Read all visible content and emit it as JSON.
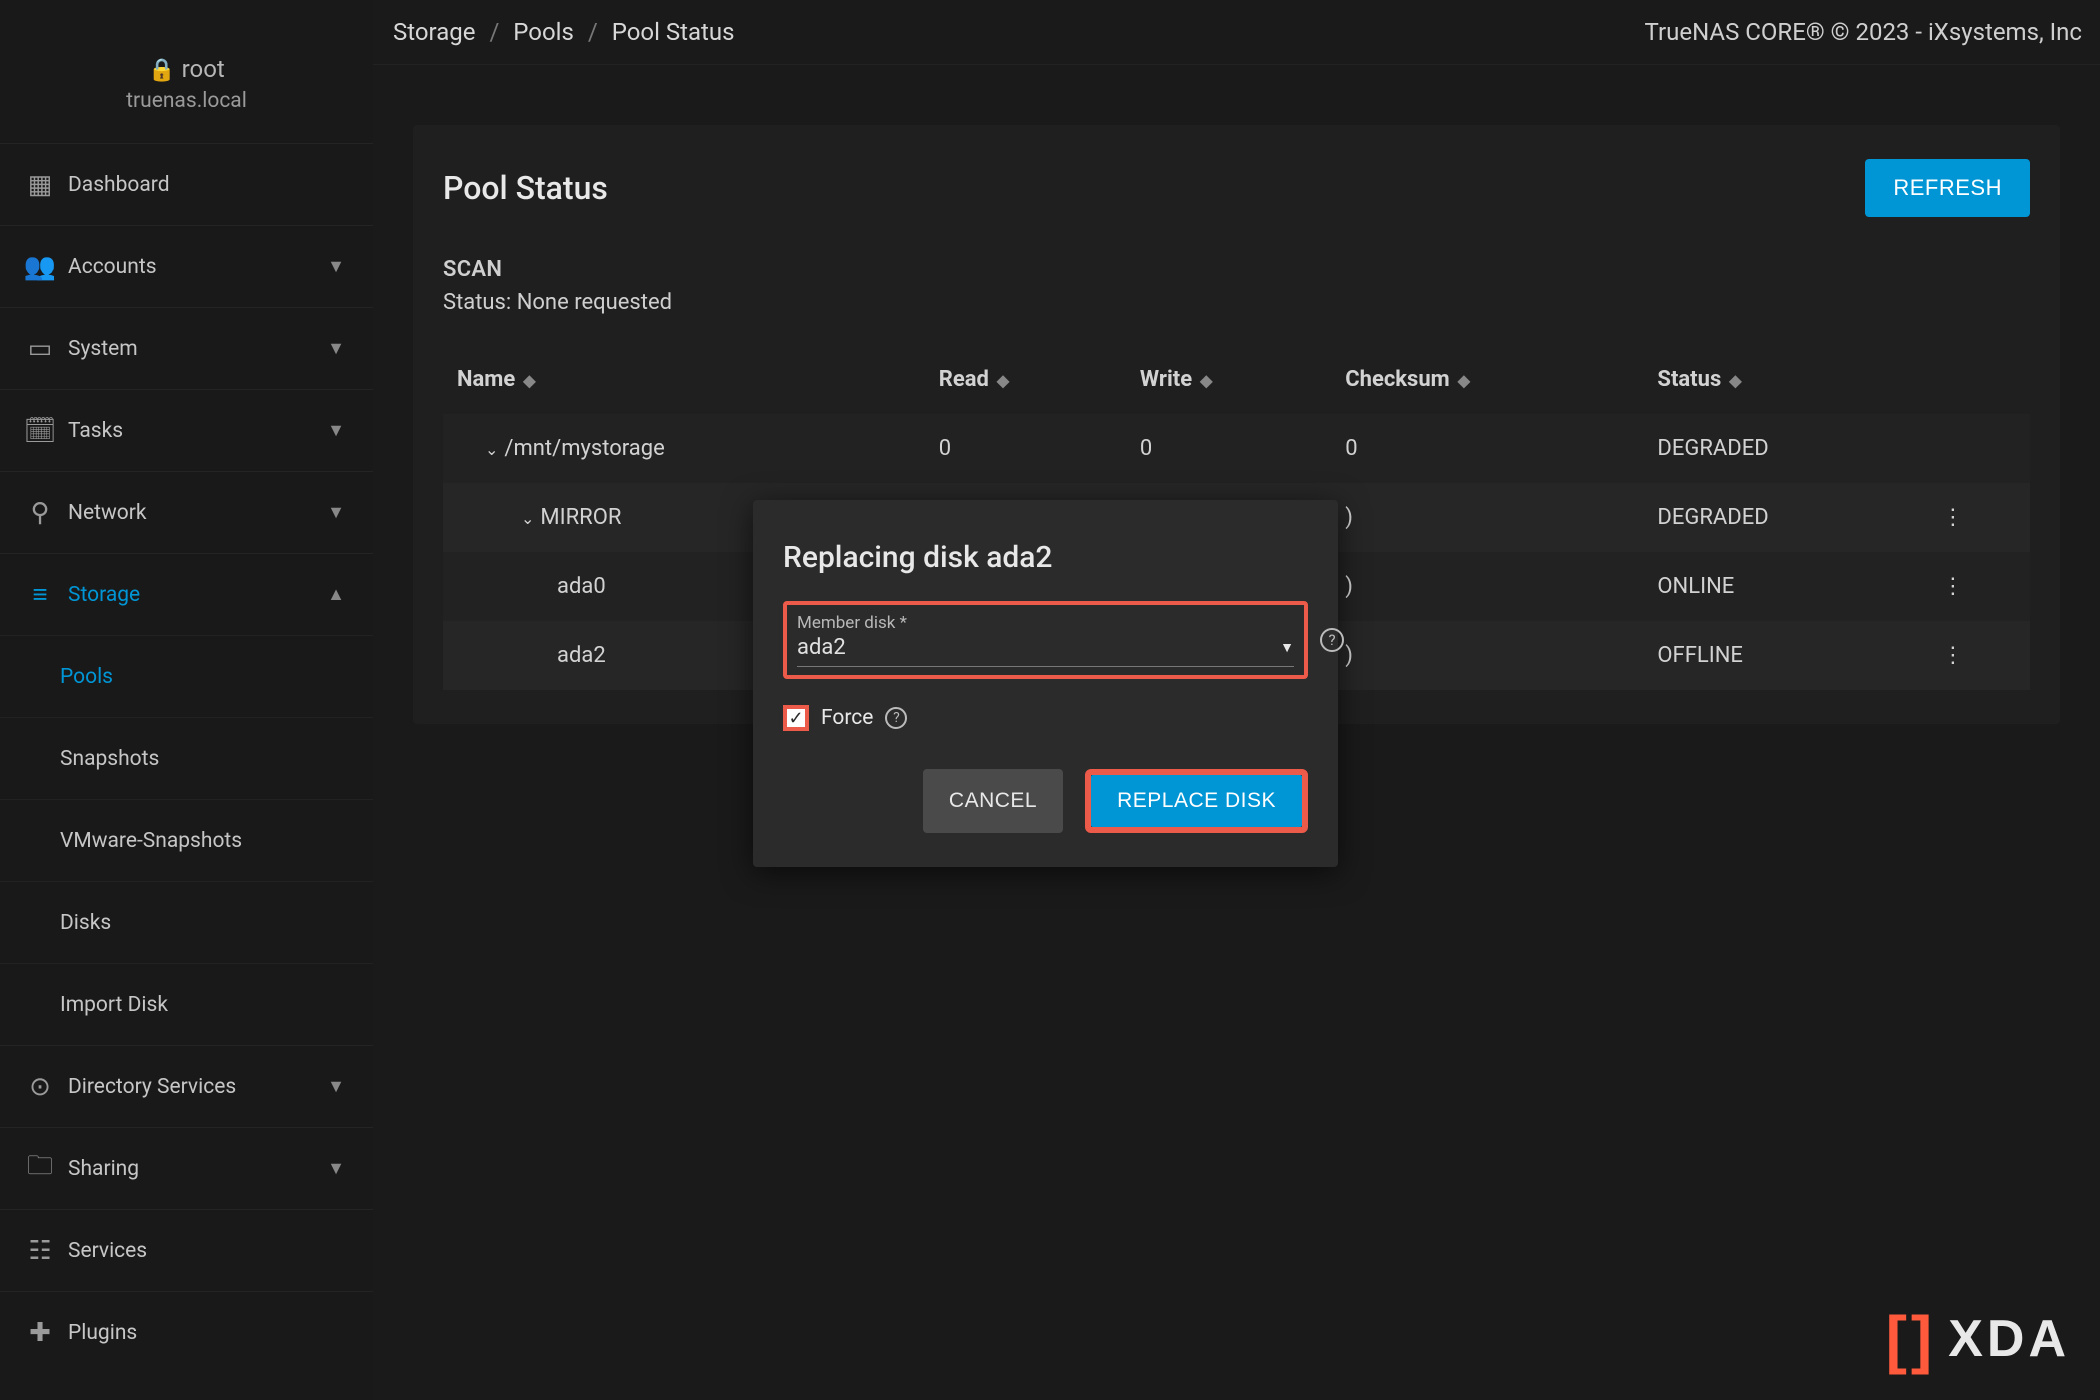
{
  "sidebar": {
    "user": "root",
    "host": "truenas.local",
    "items": [
      {
        "icon": "▦",
        "label": "Dashboard",
        "expandable": false
      },
      {
        "icon": "👥",
        "label": "Accounts",
        "expandable": true
      },
      {
        "icon": "▭",
        "label": "System",
        "expandable": true
      },
      {
        "icon": "🗓",
        "label": "Tasks",
        "expandable": true
      },
      {
        "icon": "⚲",
        "label": "Network",
        "expandable": true
      },
      {
        "icon": "≡",
        "label": "Storage",
        "expandable": true,
        "expanded": true,
        "subitems": [
          {
            "label": "Pools",
            "active": true
          },
          {
            "label": "Snapshots"
          },
          {
            "label": "VMware-Snapshots"
          },
          {
            "label": "Disks"
          },
          {
            "label": "Import Disk"
          }
        ]
      },
      {
        "icon": "⊙",
        "label": "Directory Services",
        "expandable": true
      },
      {
        "icon": "🗀",
        "label": "Sharing",
        "expandable": true
      },
      {
        "icon": "☷",
        "label": "Services",
        "expandable": false
      },
      {
        "icon": "✚",
        "label": "Plugins",
        "expandable": false
      }
    ]
  },
  "breadcrumb": [
    "Storage",
    "Pools",
    "Pool Status"
  ],
  "branding": "TrueNAS CORE® © 2023 - iXsystems, Inc",
  "page": {
    "title": "Pool Status",
    "refresh_label": "REFRESH",
    "scan_label": "SCAN",
    "scan_status": "Status: None requested",
    "columns": [
      "Name",
      "Read",
      "Write",
      "Checksum",
      "Status"
    ],
    "rows": [
      {
        "name": "/mnt/mystorage",
        "read": "0",
        "write": "0",
        "checksum": "0",
        "status": "DEGRADED",
        "indent": 1,
        "chevron": true,
        "menu": false
      },
      {
        "name": "MIRROR",
        "read": "",
        "write": "",
        "checksum": ")",
        "status": "DEGRADED",
        "indent": 2,
        "chevron": true,
        "menu": true
      },
      {
        "name": "ada0",
        "read": "",
        "write": "",
        "checksum": ")",
        "status": "ONLINE",
        "indent": 3,
        "chevron": false,
        "menu": true
      },
      {
        "name": "ada2",
        "read": "",
        "write": "",
        "checksum": ")",
        "status": "OFFLINE",
        "indent": 3,
        "chevron": false,
        "menu": true
      }
    ]
  },
  "dialog": {
    "title": "Replacing disk ada2",
    "member_label": "Member disk *",
    "member_value": "ada2",
    "force_label": "Force",
    "force_checked": true,
    "cancel_label": "CANCEL",
    "replace_label": "REPLACE DISK"
  },
  "watermark": "XDA"
}
